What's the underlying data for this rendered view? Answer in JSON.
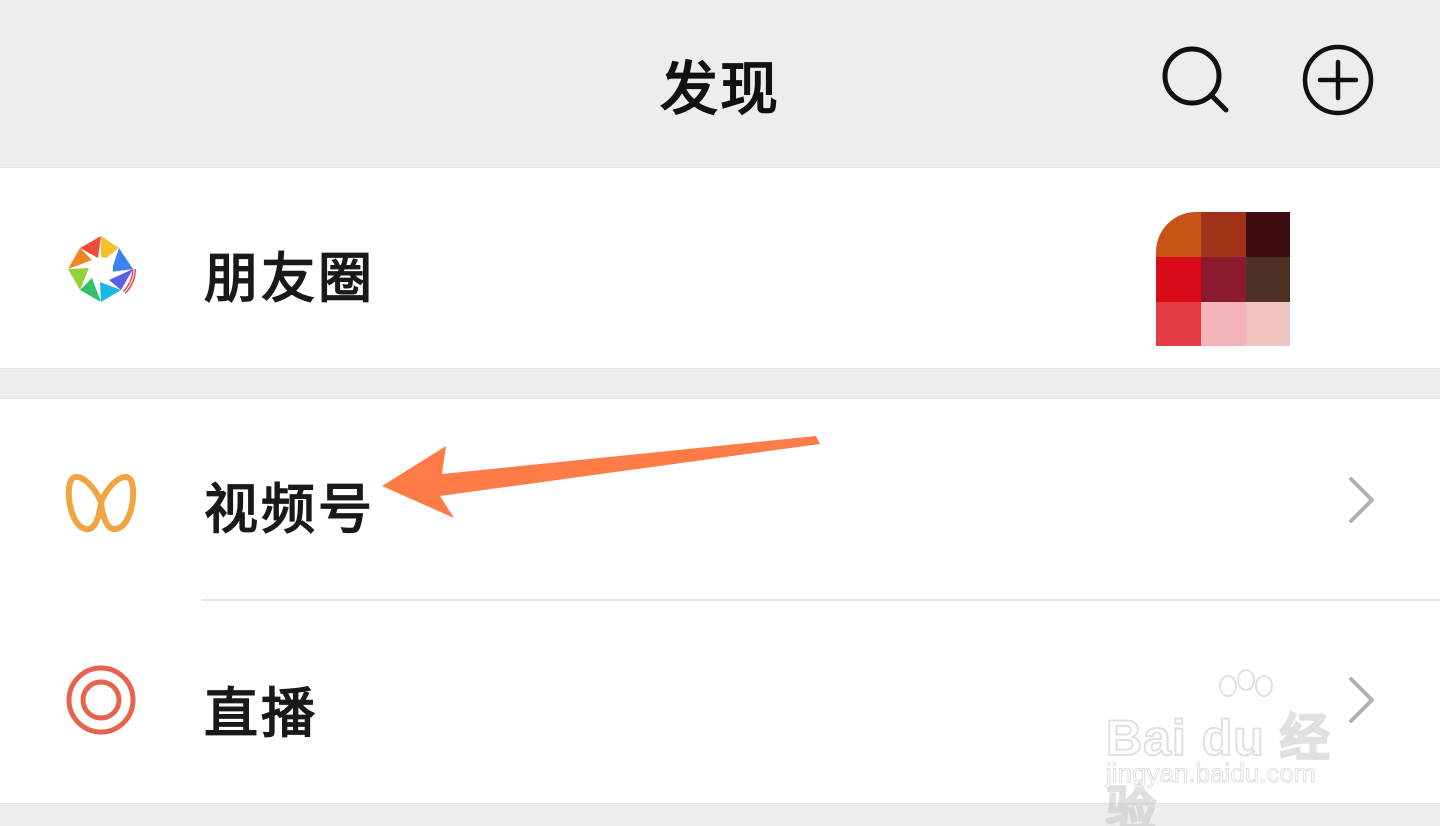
{
  "header": {
    "title": "发现",
    "search_icon": "search-icon",
    "add_icon": "plus-circle-icon"
  },
  "rows": [
    {
      "label": "朋友圈",
      "icon": "moments-aperture-icon",
      "has_thumbnail": true
    },
    {
      "label": "视频号",
      "icon": "channels-butterfly-icon",
      "icon_color": "#f0a542"
    },
    {
      "label": "直播",
      "icon": "live-target-icon",
      "icon_color": "#e8634d"
    }
  ],
  "annotation": {
    "arrow_color": "#ff7b48",
    "points_to": "视频号"
  },
  "watermark": {
    "brand": "Bai du 经验",
    "url": "jingyan.baidu.com"
  },
  "colors": {
    "background": "#ededed",
    "row_background": "#ffffff",
    "text": "#191919",
    "chevron": "#b2b2b2"
  }
}
